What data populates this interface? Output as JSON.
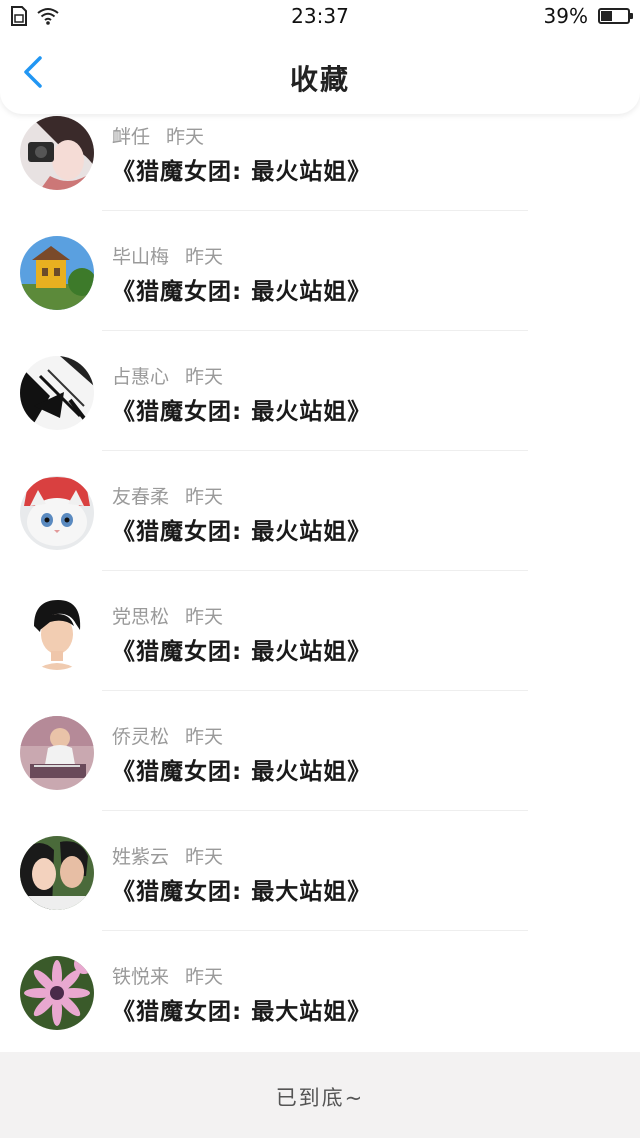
{
  "status_bar": {
    "time": "23:37",
    "battery_text": "39%",
    "battery_level": 0.39,
    "icons": [
      "sim-icon",
      "wifi-icon",
      "battery-icon"
    ]
  },
  "nav": {
    "title": "收藏",
    "back_icon": "chevron-left-icon",
    "accent_color": "#2196F3"
  },
  "items": [
    {
      "name": "衅任",
      "time": "昨天",
      "title": "《猎魔女团: 最火站姐》",
      "avatar": "avatar-girl-camera"
    },
    {
      "name": "毕山梅",
      "time": "昨天",
      "title": "《猎魔女团: 最火站姐》",
      "avatar": "avatar-yellow-house"
    },
    {
      "name": "占惠心",
      "time": "昨天",
      "title": "《猎魔女团: 最火站姐》",
      "avatar": "avatar-sketch"
    },
    {
      "name": "友春柔",
      "time": "昨天",
      "title": "《猎魔女团: 最火站姐》",
      "avatar": "avatar-kitten"
    },
    {
      "name": "党思松",
      "time": "昨天",
      "title": "《猎魔女团: 最火站姐》",
      "avatar": "avatar-short-hair"
    },
    {
      "name": "侨灵松",
      "time": "昨天",
      "title": "《猎魔女团: 最火站姐》",
      "avatar": "avatar-man-desk"
    },
    {
      "name": "姓紫云",
      "time": "昨天",
      "title": "《猎魔女团: 最大站姐》",
      "avatar": "avatar-couple"
    },
    {
      "name": "铁悦来",
      "time": "昨天",
      "title": "《猎魔女团: 最大站姐》",
      "avatar": "avatar-pink-flower"
    }
  ],
  "footer": {
    "text": "已到底~"
  }
}
